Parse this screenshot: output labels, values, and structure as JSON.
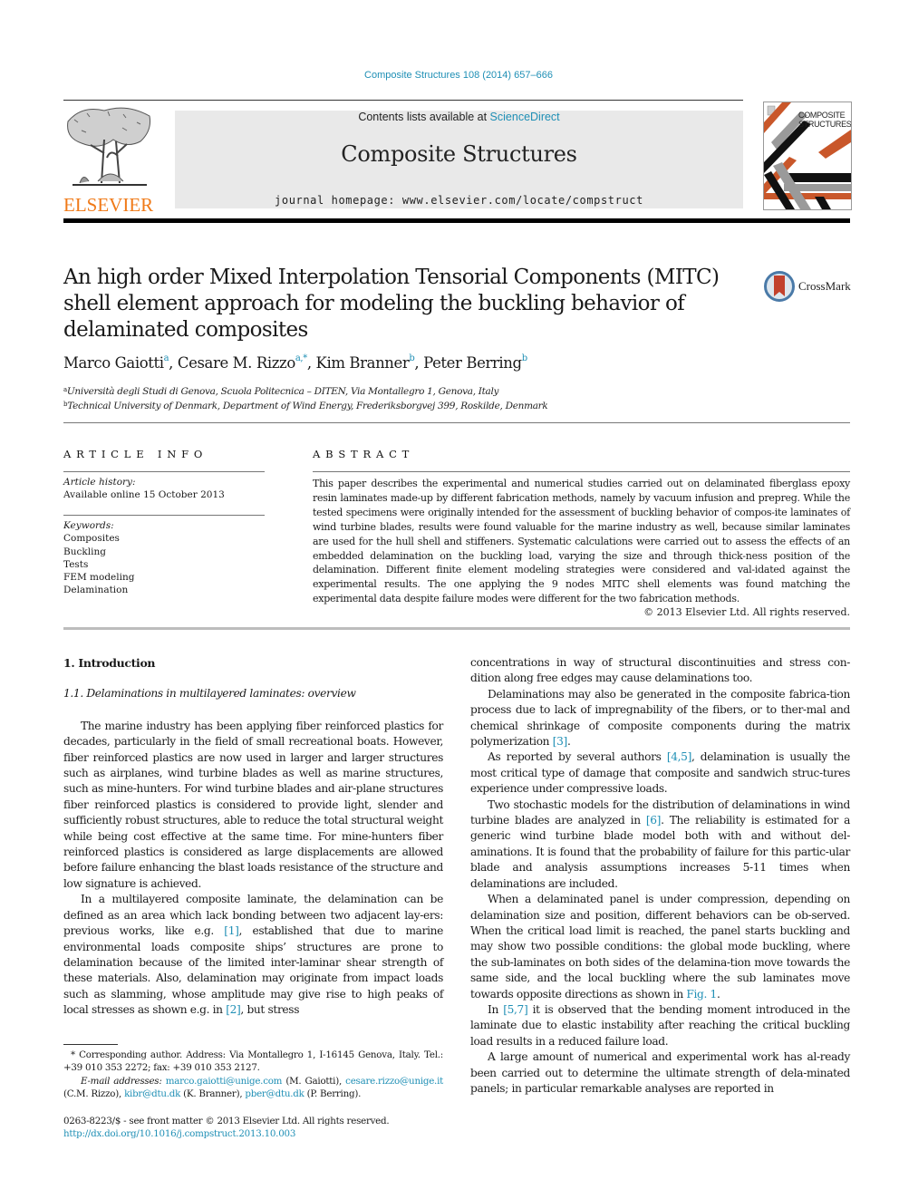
{
  "header": {
    "journal_ref": "Composite Structures 108 (2014) 657–666",
    "contents_prefix": "Contents lists available at ",
    "contents_link": "ScienceDirect",
    "journal_title": "Composite Structures",
    "homepage_prefix": "journal homepage: ",
    "homepage_url": "www.elsevier.com/locate/compstruct",
    "publisher_logo": "ELSEVIER",
    "cover_title_line1": "COMPOSITE",
    "cover_title_line2": "STRUCTURES"
  },
  "colors": {
    "link": "#1f8fb5",
    "elsevier_orange": "#f07a18",
    "banner_bg": "#e9e9e9",
    "cover_orange": "#c9572a",
    "cover_gray": "#9a9a9a"
  },
  "article": {
    "title": "An high order Mixed Interpolation Tensorial Components (MITC) shell element approach for modeling the buckling behavior of delaminated composites",
    "crossmark_label": "CrossMark",
    "authors": [
      {
        "name": "Marco Gaiotti",
        "sup": "a"
      },
      {
        "name": "Cesare M. Rizzo",
        "sup": "a,*"
      },
      {
        "name": "Kim Branner",
        "sup": "b"
      },
      {
        "name": "Peter Berring",
        "sup": "b"
      }
    ],
    "affiliations": [
      {
        "sup": "a",
        "text": "Università degli Studi di Genova, Scuola Politecnica – DITEN, Via Montallegro 1, Genova, Italy"
      },
      {
        "sup": "b",
        "text": "Technical University of Denmark, Department of Wind Energy, Frederiksborgvej 399, Roskilde, Denmark"
      }
    ]
  },
  "article_info": {
    "heading": "ARTICLE INFO",
    "history_label": "Article history:",
    "history_value": "Available online 15 October 2013",
    "keywords_label": "Keywords:",
    "keywords": [
      "Composites",
      "Buckling",
      "Tests",
      "FEM modeling",
      "Delamination"
    ]
  },
  "abstract": {
    "heading": "ABSTRACT",
    "text": "This paper describes the experimental and numerical studies carried out on delaminated fiberglass epoxy resin laminates made-up by different fabrication methods, namely by vacuum infusion and prepreg. While the tested specimens were originally intended for the assessment of buckling behavior of compos-ite laminates of wind turbine blades, results were found valuable for the marine industry as well, because similar laminates are used for the hull shell and stiffeners. Systematic calculations were carried out to assess the effects of an embedded delamination on the buckling load, varying the size and through thick-ness position of the delamination. Different finite element modeling strategies were considered and val-idated against the experimental results. The one applying the 9 nodes MITC shell elements was found matching the experimental data despite failure modes were different for the two fabrication methods.",
    "copyright": "© 2013 Elsevier Ltd. All rights reserved."
  },
  "body": {
    "section_heading": "1. Introduction",
    "subsection_heading": "1.1. Delaminations in multilayered laminates: overview",
    "left_paragraphs": [
      {
        "parts": [
          {
            "t": "The marine industry has been applying fiber reinforced plastics for decades, particularly in the field of small recreational boats. However, fiber reinforced plastics are now used in larger and larger structures such as airplanes, wind turbine blades as well as marine structures, such as mine-hunters. For wind turbine blades and air-plane structures fiber reinforced plastics is considered to provide light, slender and sufficiently robust structures, able to reduce the total structural weight while being cost effective at the same time. For mine-hunters fiber reinforced plastics is considered as large displacements are allowed before failure enhancing the blast loads resistance of the structure and low signature is achieved."
          }
        ]
      },
      {
        "parts": [
          {
            "t": "In a multilayered composite laminate, the delamination can be defined as an area which lack bonding between two adjacent lay-ers: previous works, like e.g. "
          },
          {
            "t": "[1]",
            "link": true
          },
          {
            "t": ", established that due to marine environmental loads composite ships’ structures are prone to delamination because of the limited inter-laminar shear strength of these materials. Also, delamination may originate from impact loads such as slamming, whose amplitude may give rise to high peaks of local stresses as shown e.g. in "
          },
          {
            "t": "[2]",
            "link": true
          },
          {
            "t": ", but stress"
          }
        ]
      }
    ],
    "right_paragraphs": [
      {
        "noindent": true,
        "parts": [
          {
            "t": "concentrations in way of structural discontinuities and stress con-dition along free edges may cause delaminations too."
          }
        ]
      },
      {
        "parts": [
          {
            "t": "Delaminations may also be generated in the composite fabrica-tion process due to lack of impregnability of the fibers, or to ther-mal and chemical shrinkage of composite components during the matrix polymerization "
          },
          {
            "t": "[3]",
            "link": true
          },
          {
            "t": "."
          }
        ]
      },
      {
        "parts": [
          {
            "t": "As reported by several authors "
          },
          {
            "t": "[4,5]",
            "link": true
          },
          {
            "t": ", delamination is usually the most critical type of damage that composite and sandwich struc-tures experience under compressive loads."
          }
        ]
      },
      {
        "parts": [
          {
            "t": "Two stochastic models for the distribution of delaminations in wind turbine blades are analyzed in "
          },
          {
            "t": "[6]",
            "link": true
          },
          {
            "t": ". The reliability is estimated for a generic wind turbine blade model both with and without del-aminations. It is found that the probability of failure for this partic-ular blade and analysis assumptions increases 5-11 times when delaminations are included."
          }
        ]
      },
      {
        "parts": [
          {
            "t": "When a delaminated panel is under compression, depending on delamination size and position, different behaviors can be ob-served. When the critical load limit is reached, the panel starts buckling and may show two possible conditions: the global mode buckling, where the sub-laminates on both sides of the delamina-tion move towards the same side, and the local buckling where the sub laminates move towards opposite directions as shown in "
          },
          {
            "t": "Fig. 1",
            "link": true
          },
          {
            "t": "."
          }
        ]
      },
      {
        "parts": [
          {
            "t": "In "
          },
          {
            "t": "[5,7]",
            "link": true
          },
          {
            "t": " it is observed that the bending moment introduced in the laminate due to elastic instability after reaching the critical buckling load results in a reduced failure load."
          }
        ]
      },
      {
        "parts": [
          {
            "t": "A large amount of numerical and experimental work has al-ready been carried out to determine the ultimate strength of dela-minated panels; in particular remarkable analyses are reported in"
          }
        ]
      }
    ]
  },
  "footnotes": {
    "corresponding": "* Corresponding author. Address: Via Montallegro 1, I-16145 Genova, Italy. Tel.: +39 010 353 2272; fax: +39 010 353 2127.",
    "email_label": "E-mail addresses:",
    "emails": [
      {
        "address": "marco.gaiotti@unige.com",
        "who": "(M. Gaiotti)"
      },
      {
        "address": "cesare.rizzo@unige.it",
        "who": "(C.M. Rizzo)"
      },
      {
        "address": "kibr@dtu.dk",
        "who": "(K. Branner)"
      },
      {
        "address": "pber@dtu.dk",
        "who": "(P. Berring)"
      }
    ],
    "issn_line": "0263-8223/$ - see front matter © 2013 Elsevier Ltd. All rights reserved.",
    "doi": "http://dx.doi.org/10.1016/j.compstruct.2013.10.003"
  }
}
